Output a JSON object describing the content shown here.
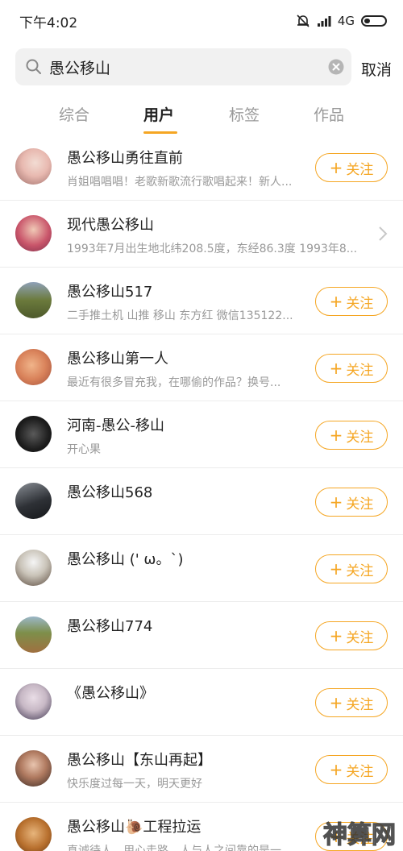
{
  "status_bar": {
    "time": "下午4:02",
    "network": "4G"
  },
  "search": {
    "value": "愚公移山",
    "cancel": "取消"
  },
  "tabs": [
    {
      "label": "综合"
    },
    {
      "label": "用户"
    },
    {
      "label": "标签"
    },
    {
      "label": "作品"
    }
  ],
  "active_tab": "用户",
  "follow_label": "关注",
  "results": [
    {
      "name": "愚公移山勇往直前",
      "desc": "肖姐唱唱唱！老歌新歌流行歌唱起来！新人...",
      "action": "follow",
      "avatar_color": "#e8b9b0"
    },
    {
      "name": "现代愚公移山",
      "desc": "1993年7月出生地北纬208.5度，东经86.3度 1993年8...",
      "action": "chevron",
      "avatar_color": "#c9556a"
    },
    {
      "name": "愚公移山517",
      "desc": "二手推土机 山推 移山 东方红 微信135122...",
      "action": "follow",
      "avatar_color": "#6b7a3c"
    },
    {
      "name": "愚公移山第一人",
      "desc": "最近有很多冒充我，在哪偷的作品？换号...",
      "action": "follow",
      "avatar_color": "#d9825a"
    },
    {
      "name": "河南-愚公-移山",
      "desc": "开心果",
      "action": "follow",
      "avatar_color": "#1d1d1d"
    },
    {
      "name": "愚公移山568",
      "desc": "",
      "action": "follow",
      "avatar_color": "#2e3136"
    },
    {
      "name": "愚公移山 (' ω。`)",
      "desc": "",
      "action": "follow",
      "avatar_color": "#c9c3b8"
    },
    {
      "name": "愚公移山774",
      "desc": "",
      "action": "follow",
      "avatar_color": "#a07040"
    },
    {
      "name": "《愚公移山》",
      "desc": "",
      "action": "follow",
      "avatar_color": "#c7b8c5"
    },
    {
      "name": "愚公移山【东山再起】",
      "desc": "快乐度过每一天，明天更好",
      "action": "follow",
      "avatar_color": "#6e4c3a"
    },
    {
      "name": "愚公移山🐌工程拉运",
      "desc": "真诚待人，用心走路。人与人之间靠的是一...",
      "action": "follow",
      "avatar_color": "#b8702e"
    }
  ],
  "watermark": "神算网"
}
